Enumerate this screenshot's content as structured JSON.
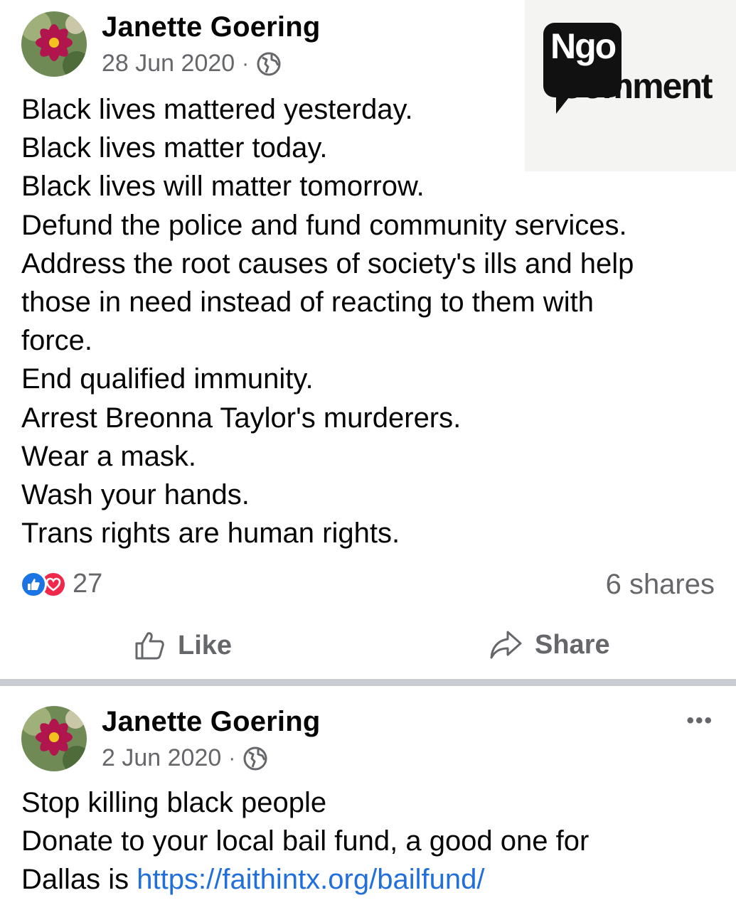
{
  "brand": {
    "logo_line1": "Ngo",
    "logo_line2": "Comment"
  },
  "posts": [
    {
      "author": "Janette Goering",
      "date": "28 Jun 2020",
      "separator": "·",
      "privacy_icon": "globe-icon",
      "lines": [
        "Black lives mattered yesterday.",
        "Black lives matter today.",
        "Black lives will matter tomorrow.",
        "Defund the police and fund community services.",
        "Address the root causes of society's ills and help",
        "those in need instead of reacting to them with",
        "force.",
        "End qualified immunity.",
        "Arrest Breonna Taylor's murderers.",
        "Wear a mask.",
        "Wash your hands.",
        "Trans rights are human rights."
      ],
      "reaction_count": "27",
      "reactions": [
        "like-reaction-icon",
        "love-reaction-icon"
      ],
      "shares": "6 shares",
      "actions": {
        "like": "Like",
        "share": "Share"
      }
    },
    {
      "author": "Janette Goering",
      "date": "2 Jun 2020",
      "separator": "·",
      "privacy_icon": "globe-icon",
      "more_label": "•••",
      "lines": [
        "Stop killing black people",
        "Donate to your local bail fund, a good one for"
      ],
      "last_line_prefix": "Dallas is ",
      "link": "https://faithintx.org/bailfund/"
    }
  ],
  "colors": {
    "link": "#216fdb",
    "secondary_text": "#65676b",
    "like_blue": "#1b74e4",
    "love_red": "#f0284a",
    "divider": "#c9ccd1"
  }
}
